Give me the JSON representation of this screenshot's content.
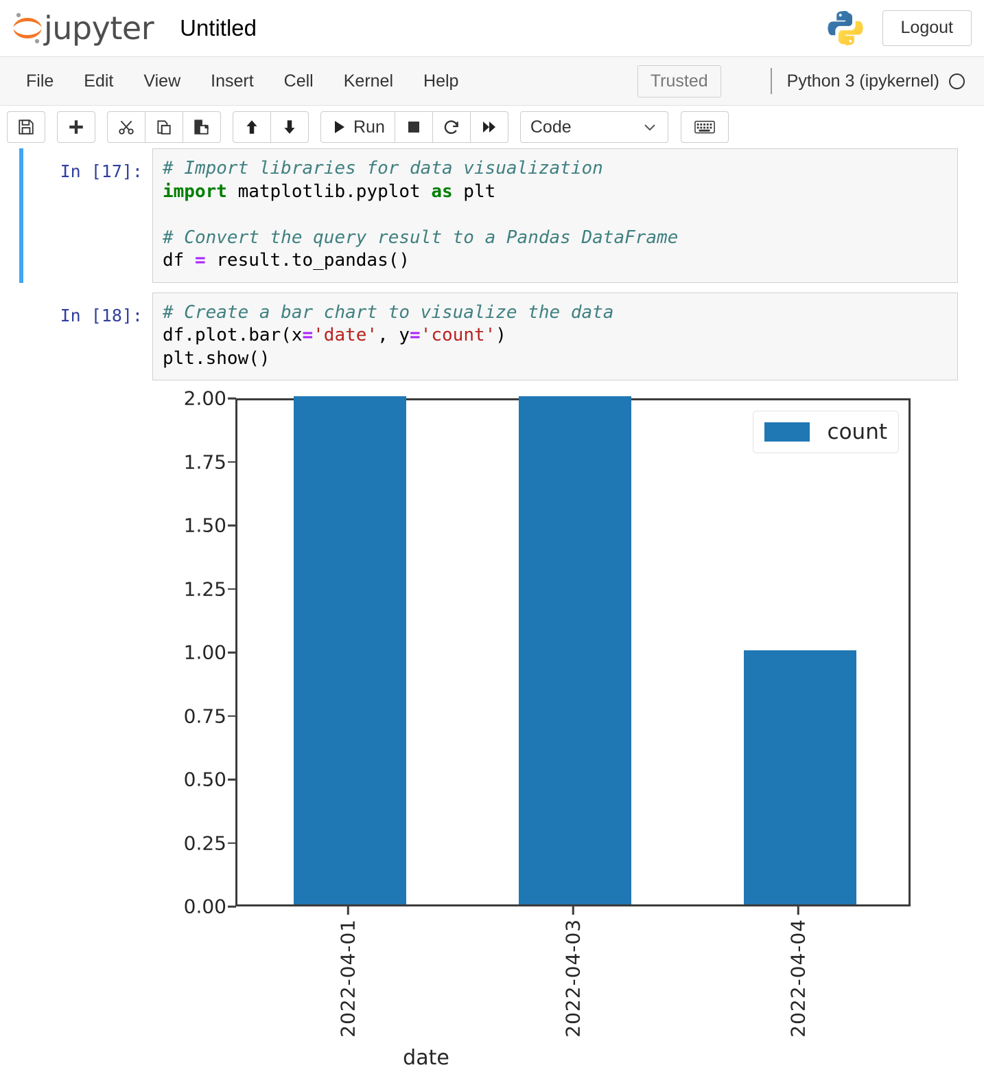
{
  "header": {
    "logo_text": "jupyter",
    "logo_icon": "jupyter-logo-icon",
    "notebook_title": "Untitled",
    "python_icon": "python-logo-icon",
    "logout_label": "Logout"
  },
  "menubar": {
    "items": [
      {
        "label": "File"
      },
      {
        "label": "Edit"
      },
      {
        "label": "View"
      },
      {
        "label": "Insert"
      },
      {
        "label": "Cell"
      },
      {
        "label": "Kernel"
      },
      {
        "label": "Help"
      }
    ],
    "trusted_label": "Trusted",
    "kernel_name": "Python 3 (ipykernel)",
    "kernel_status_icon": "kernel-idle-circle-icon"
  },
  "toolbar": {
    "save_icon": "save-floppy-icon",
    "add_icon": "plus-icon",
    "cut_icon": "scissors-icon",
    "copy_icon": "copy-icon",
    "paste_icon": "paste-icon",
    "move_up_icon": "arrow-up-icon",
    "move_down_icon": "arrow-down-icon",
    "run_icon": "play-icon",
    "run_label": "Run",
    "stop_icon": "stop-square-icon",
    "restart_icon": "restart-circular-arrow-icon",
    "restart_run_all_icon": "fast-forward-icon",
    "celltype_value": "Code",
    "celltype_chevron_icon": "chevron-down-icon",
    "keyboard_icon": "keyboard-icon"
  },
  "cells": [
    {
      "prompt": "In [17]:",
      "selected": true,
      "lines": [
        [
          {
            "t": "# Import libraries for data visualization",
            "c": "c-comment"
          }
        ],
        [
          {
            "t": "import",
            "c": "c-kw"
          },
          {
            "t": " matplotlib.pyplot ",
            "c": ""
          },
          {
            "t": "as",
            "c": "c-kw"
          },
          {
            "t": " plt",
            "c": ""
          }
        ],
        [
          {
            "t": "",
            "c": ""
          }
        ],
        [
          {
            "t": "# Convert the query result to a Pandas DataFrame",
            "c": "c-comment"
          }
        ],
        [
          {
            "t": "df ",
            "c": ""
          },
          {
            "t": "=",
            "c": "c-op"
          },
          {
            "t": " result.to_pandas()",
            "c": ""
          }
        ]
      ]
    },
    {
      "prompt": "In [18]:",
      "selected": false,
      "lines": [
        [
          {
            "t": "# Create a bar chart to visualize the data",
            "c": "c-comment"
          }
        ],
        [
          {
            "t": "df.plot.bar(x",
            "c": ""
          },
          {
            "t": "=",
            "c": "c-op"
          },
          {
            "t": "'date'",
            "c": "c-str"
          },
          {
            "t": ", y",
            "c": ""
          },
          {
            "t": "=",
            "c": "c-op"
          },
          {
            "t": "'count'",
            "c": "c-str"
          },
          {
            "t": ")",
            "c": ""
          }
        ],
        [
          {
            "t": "plt.show()",
            "c": ""
          }
        ]
      ]
    }
  ],
  "chart_data": {
    "type": "bar",
    "title": "",
    "xlabel": "date",
    "ylabel": "",
    "categories": [
      "2022-04-01",
      "2022-04-03",
      "2022-04-04"
    ],
    "series": [
      {
        "name": "count",
        "values": [
          2,
          2,
          1
        ],
        "color": "#1f77b4"
      }
    ],
    "ylim": [
      0,
      2
    ],
    "yticks": [
      "0.00",
      "0.25",
      "0.50",
      "0.75",
      "1.00",
      "1.25",
      "1.50",
      "1.75",
      "2.00"
    ],
    "ytick_values": [
      0,
      0.25,
      0.5,
      0.75,
      1.0,
      1.25,
      1.5,
      1.75,
      2.0
    ],
    "grid": false,
    "legend_position": "upper right",
    "legend_entries": [
      "count"
    ]
  }
}
